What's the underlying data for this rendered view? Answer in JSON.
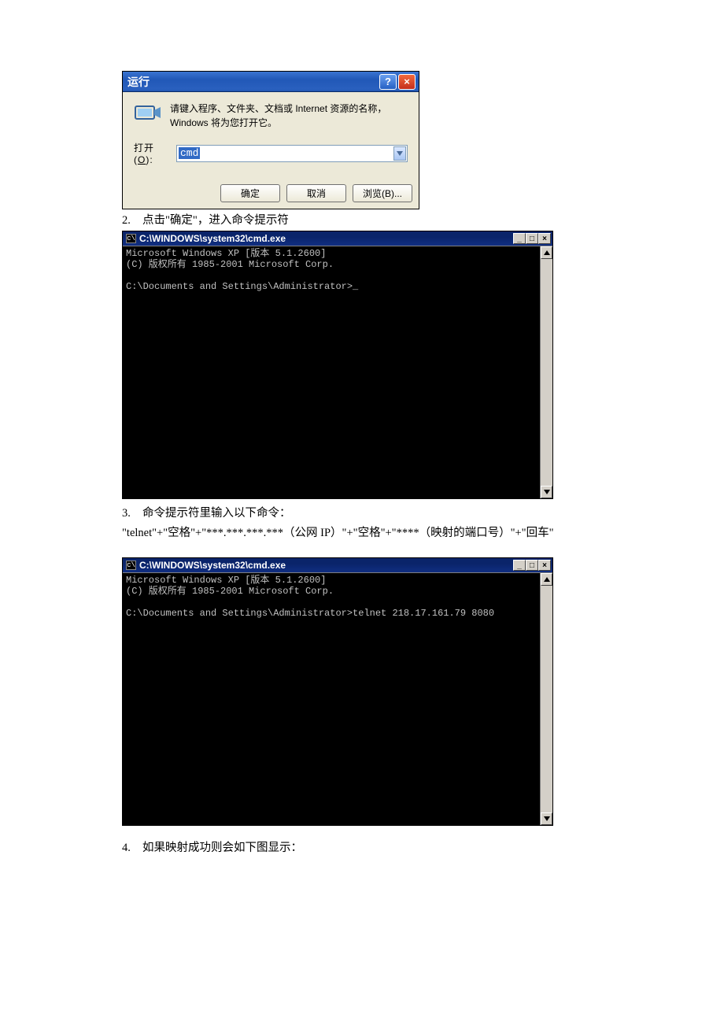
{
  "run_dialog": {
    "title": "运行",
    "description": "请键入程序、文件夹、文档或 Internet 资源的名称，Windows 将为您打开它。",
    "open_label_prefix": "打开(",
    "open_hotkey": "O",
    "open_label_suffix": "):",
    "input_value": "cmd",
    "ok_label": "确定",
    "cancel_label": "取消",
    "browse_label": "浏览(B)..."
  },
  "step2": {
    "num": "2.",
    "text": "点击\"确定\"，进入命令提示符"
  },
  "cmd1": {
    "title": "C:\\WINDOWS\\system32\\cmd.exe",
    "line1": "Microsoft Windows XP [版本 5.1.2600]",
    "line2": "(C) 版权所有 1985-2001 Microsoft Corp.",
    "prompt": "C:\\Documents and Settings\\Administrator>"
  },
  "step3": {
    "num": "3.",
    "text": "命令提示符里输入以下命令：",
    "cmdline": "\"telnet\"+\"空格\"+\"***.***.***.***（公网 IP）\"+\"空格\"+\"****（映射的端口号）\"+\"回车\""
  },
  "cmd2": {
    "title": "C:\\WINDOWS\\system32\\cmd.exe",
    "line1": "Microsoft Windows XP [版本 5.1.2600]",
    "line2": "(C) 版权所有 1985-2001 Microsoft Corp.",
    "prompt": "C:\\Documents and Settings\\Administrator>",
    "typed": "telnet 218.17.161.79 8080"
  },
  "step4": {
    "num": "4.",
    "text": "如果映射成功则会如下图显示："
  }
}
